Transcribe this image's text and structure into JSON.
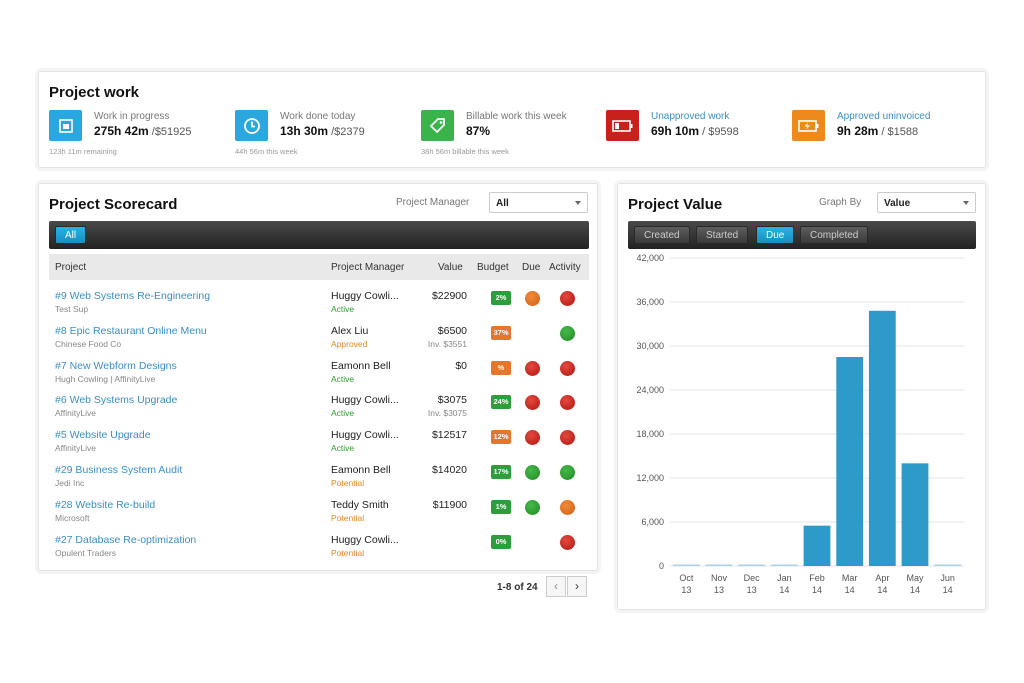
{
  "project_work": {
    "title": "Project work",
    "metrics": [
      {
        "label": "Work in progress",
        "value_bold": "275h 42m",
        "value_rest": " /$51925",
        "sub": "123h 11m remaining",
        "color": "#2aa7df",
        "icon": "calendar-icon"
      },
      {
        "label": "Work done today",
        "value_bold": "13h 30m",
        "value_rest": " /$2379",
        "sub": "44h 56m this week",
        "color": "#2aa7df",
        "icon": "clock-icon"
      },
      {
        "label": "Billable work this week",
        "value_bold": "87%",
        "value_rest": "",
        "sub": "38h 56m billable this week",
        "color": "#3ab34a",
        "icon": "tag-icon"
      },
      {
        "label": "Unapproved work",
        "value_bold": "69h 10m",
        "value_rest": " / $9598",
        "sub": "",
        "color": "#c8201a",
        "icon": "battery-low-icon"
      },
      {
        "label": "Approved uninvoiced",
        "value_bold": "9h 28m",
        "value_rest": " / $1588",
        "sub": "",
        "color": "#ee8a1c",
        "icon": "battery-charging-icon"
      }
    ]
  },
  "scorecard": {
    "title": "Project Scorecard",
    "manager_label": "Project Manager",
    "manager_value": "All",
    "filter_tab": "All",
    "headers": {
      "project": "Project",
      "manager": "Project Manager",
      "value": "Value",
      "budget": "Budget",
      "due": "Due",
      "activity": "Activity"
    },
    "rows": [
      {
        "name": "#9 Web Systems Re-Engineering",
        "client": "Test Sup",
        "manager": "Huggy Cowli...",
        "status": "Active",
        "status_class": "active",
        "value": "$22900",
        "inv": "",
        "budget": "2%",
        "budget_color": "g",
        "due": "o",
        "activity": "r"
      },
      {
        "name": "#8 Epic Restaurant Online Menu",
        "client": "Chinese Food Co",
        "manager": "Alex Liu",
        "status": "Approved",
        "status_class": "approved",
        "value": "$6500",
        "inv": "Inv. $3551",
        "budget": "37%",
        "budget_color": "o",
        "due": "",
        "activity": "g"
      },
      {
        "name": "#7 New Webform Designs",
        "client": "Hugh Cowling | AffinityLive",
        "manager": "Eamonn Bell",
        "status": "Active",
        "status_class": "active",
        "value": "$0",
        "inv": "",
        "budget": "%",
        "budget_color": "o",
        "due": "r",
        "activity": "r"
      },
      {
        "name": "#6 Web Systems Upgrade",
        "client": "AffinityLive",
        "manager": "Huggy Cowli...",
        "status": "Active",
        "status_class": "active",
        "value": "$3075",
        "inv": "Inv. $3075",
        "budget": "24%",
        "budget_color": "g",
        "due": "r",
        "activity": "r"
      },
      {
        "name": "#5 Website Upgrade",
        "client": "AffinityLive",
        "manager": "Huggy Cowli...",
        "status": "Active",
        "status_class": "active",
        "value": "$12517",
        "inv": "",
        "budget": "12%",
        "budget_color": "o",
        "due": "r",
        "activity": "r"
      },
      {
        "name": "#29 Business System Audit",
        "client": "Jedi Inc",
        "manager": "Eamonn Bell",
        "status": "Potential",
        "status_class": "potential",
        "value": "$14020",
        "inv": "",
        "budget": "17%",
        "budget_color": "g",
        "due": "g",
        "activity": "g"
      },
      {
        "name": "#28 Website Re-build",
        "client": "Microsoft",
        "manager": "Teddy Smith",
        "status": "Potential",
        "status_class": "potential",
        "value": "$11900",
        "inv": "",
        "budget": "1%",
        "budget_color": "g",
        "due": "g",
        "activity": "o"
      },
      {
        "name": "#27 Database Re-optimization",
        "client": "Opulent Traders",
        "manager": "Huggy Cowli...",
        "status": "Potential",
        "status_class": "potential",
        "value": "",
        "inv": "",
        "budget": "0%",
        "budget_color": "g",
        "due": "",
        "activity": "r"
      }
    ],
    "pager": "1-8 of 24",
    "prev": "‹",
    "next": "›"
  },
  "project_value": {
    "title": "Project Value",
    "graph_by_label": "Graph By",
    "graph_by_value": "Value",
    "tabs": [
      "Created",
      "Started",
      "Due",
      "Completed"
    ],
    "active_tab": "Due"
  },
  "chart_data": {
    "type": "bar",
    "categories": [
      [
        "Oct",
        "13"
      ],
      [
        "Nov",
        "13"
      ],
      [
        "Dec",
        "13"
      ],
      [
        "Jan",
        "14"
      ],
      [
        "Feb",
        "14"
      ],
      [
        "Mar",
        "14"
      ],
      [
        "Apr",
        "14"
      ],
      [
        "May",
        "14"
      ],
      [
        "Jun",
        "14"
      ]
    ],
    "values": [
      0,
      0,
      0,
      0,
      5500,
      28500,
      34800,
      14000,
      0
    ],
    "yticks": [
      "0",
      "6,000",
      "12,000",
      "18,000",
      "24,000",
      "30,000",
      "36,000",
      "42,000"
    ],
    "ylim": [
      0,
      42000
    ],
    "grid": true,
    "bar_color": "#2e9ac9"
  }
}
